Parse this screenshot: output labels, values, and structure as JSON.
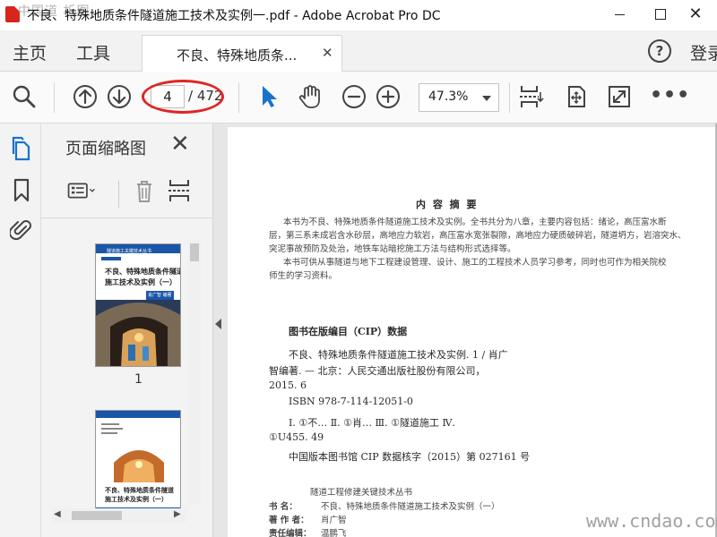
{
  "watermark_top": "中国道 析图",
  "window": {
    "title": "不良、特殊地质条件隧道施工技术及实例一.pdf - Adobe Acrobat Pro DC"
  },
  "tabs": {
    "home": "主页",
    "tools": "工具",
    "document": "不良、特殊地质条...",
    "help": "?",
    "signin": "登录"
  },
  "toolbar": {
    "current_page": "4",
    "total_pages": "/ 472",
    "zoom": "47.3%"
  },
  "panel": {
    "title": "页面缩略图",
    "thumbnails": [
      {
        "label": "1",
        "series": "隧道施工关键技术丛书",
        "title_line1": "不良、特殊地质条件隧道",
        "title_line2": "施工技术及实例（一）",
        "author": "肖广智 编著"
      },
      {
        "title_line1": "不良、特殊地质条件隧道",
        "title_line2": "施工技术及实例（一）"
      }
    ]
  },
  "document": {
    "heading": "内 容 摘 要",
    "abstract": [
      "本书为不良、特殊地质条件隧道施工技术及实例。全书共分为八章，主要内容包括：绪论，高压富水断",
      "层，第三系未成岩含水砂层，高地应力软岩，高压富水宽张裂隙，高地应力硬质破碎岩，隧道坍方，岩溶突水、",
      "突泥事故预防及处治，地铁车站暗挖施工方法与结构形式选择等。",
      "本书可供从事隧道与地下工程建设管理、设计、施工的工程技术人员学习参考，同时也可作为相关院校",
      "师生的学习资料。"
    ],
    "cip_heading": "图书在版编目（CIP）数据",
    "cip_lines": [
      "不良、特殊地质条件隧道施工技术及实例. 1 / 肖广",
      "智编著. — 北京：人民交通出版社股份有限公司，",
      "2015. 6",
      "ISBN 978-7-114-12051-0",
      "Ⅰ. ①不… Ⅱ. ①肖… Ⅲ. ①隧道施工 Ⅳ.",
      "①U455. 49",
      "中国版本图书馆 CIP 数据核字（2015）第 027161 号"
    ],
    "series": "隧道工程修建关键技术丛书",
    "book_label": "书    名：",
    "book_value": "不良、特殊地质条件隧道施工技术及实例（一）",
    "author_label": "著 作 者：",
    "author_value": "肖广智",
    "editor_label": "责任编辑：",
    "editor_value": "温鹏飞"
  },
  "watermark_bottom": "www.cndao.com",
  "colors": {
    "accent_blue": "#1a73c9",
    "annotation_red": "#e02424"
  }
}
